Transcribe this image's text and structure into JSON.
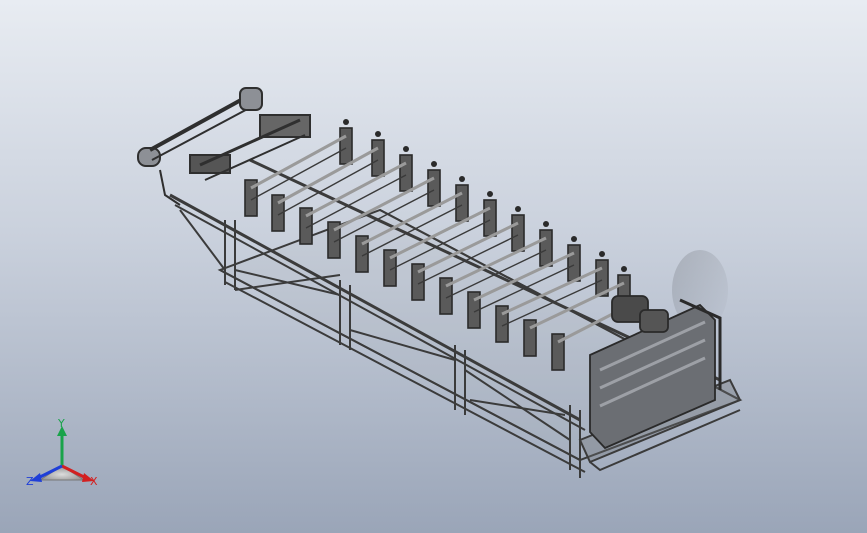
{
  "viewport": {
    "background_top": "#e8ecf2",
    "background_bottom": "#9aa5b8",
    "model_color": "#4d4d4d",
    "model_highlight": "#8a8a8a"
  },
  "triad": {
    "icon": "coordinate-triad-icon",
    "y_label": "Y",
    "x_label": "X",
    "z_label": "Z",
    "y_color": "#19a34a",
    "x_color": "#d32020",
    "z_color": "#1f3fd8"
  }
}
